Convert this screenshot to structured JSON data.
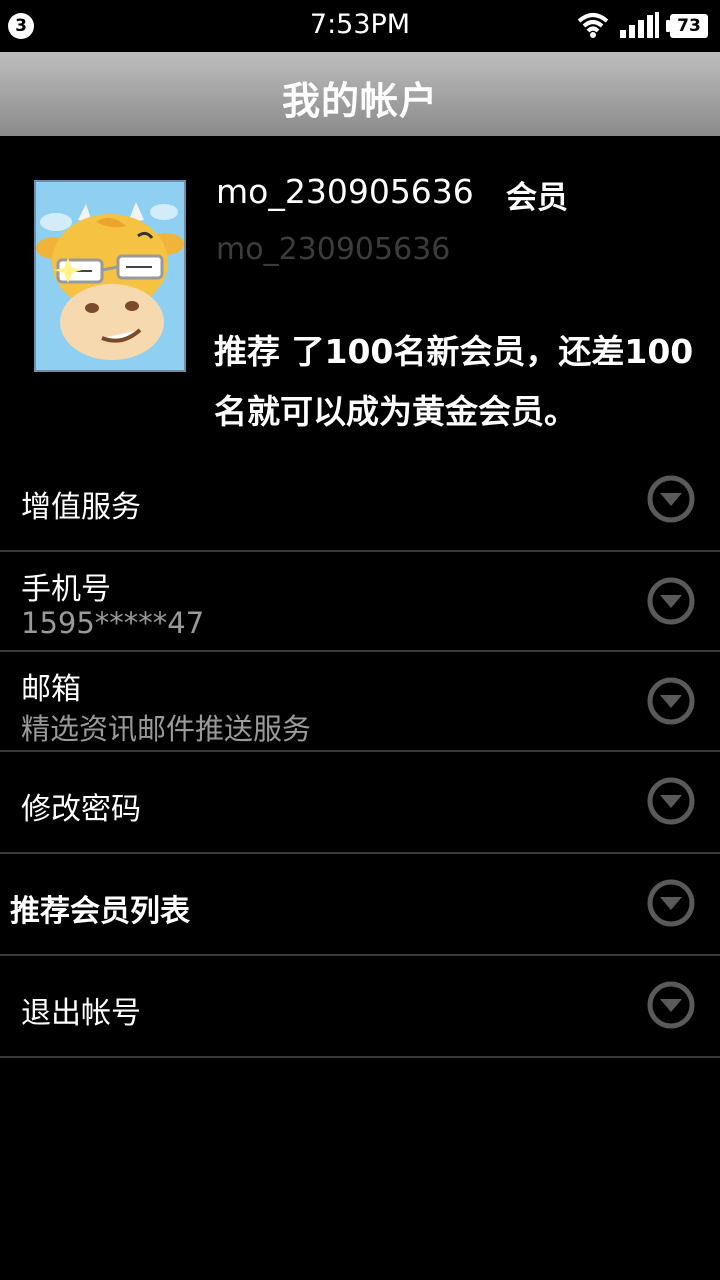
{
  "status_bar": {
    "notification_count": "3",
    "time": "7:53PM",
    "battery": "73",
    "icons": [
      "wifi-icon",
      "signal-icon",
      "battery-icon"
    ]
  },
  "header": {
    "title": "我的帐户"
  },
  "profile": {
    "username": "mo_230905636",
    "member_label": "会员",
    "sub_username": "mo_230905636",
    "referral_text": "推荐 了100名新会员，还差100名就可以成为黄金会员。",
    "avatar": "cartoon-cow-avatar"
  },
  "menu": {
    "items": [
      {
        "title": "增值服务",
        "subtitle": ""
      },
      {
        "title": "手机号",
        "subtitle": "1595*****47"
      },
      {
        "title": "邮箱",
        "subtitle": "精选资讯邮件推送服务"
      },
      {
        "title": "修改密码",
        "subtitle": ""
      },
      {
        "title": "推荐会员列表",
        "subtitle": ""
      },
      {
        "title": "退出帐号",
        "subtitle": ""
      }
    ],
    "expand_icon": "chevron-down-circle-icon"
  },
  "colors": {
    "background": "#000000",
    "title_bar": "#a0a0a0",
    "secondary_text": "#9a9a9a",
    "divider": "#3a3a3a",
    "avatar_bg": "#8fd0f2"
  }
}
